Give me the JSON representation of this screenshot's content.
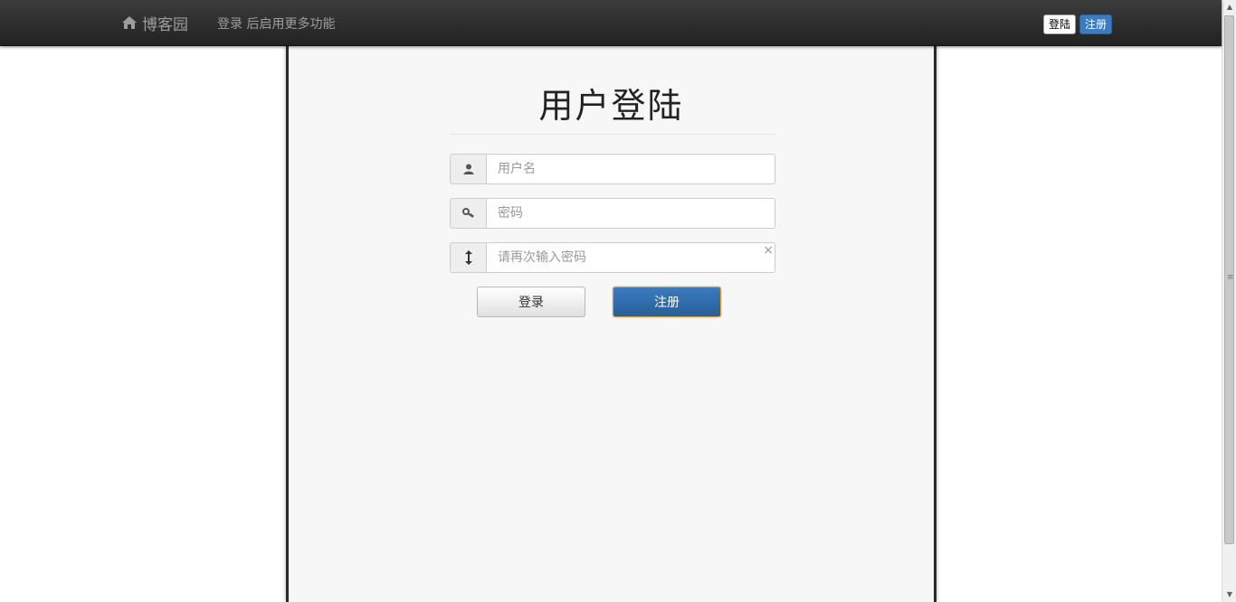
{
  "navbar": {
    "brand": "博客园",
    "brand_icon": "home-icon",
    "message": "登录 后启用更多功能",
    "login_label": "登陆",
    "register_label": "注册"
  },
  "form": {
    "title": "用户登陆",
    "username": {
      "placeholder": "用户名",
      "icon": "user-icon"
    },
    "password": {
      "placeholder": "密码",
      "icon": "key-icon"
    },
    "confirm": {
      "placeholder": "请再次输入密码",
      "icon": "vertical-arrows-icon",
      "clear": "×"
    },
    "login_button": "登录",
    "register_button": "注册"
  },
  "colors": {
    "navbar": "#2b2b2b",
    "primary": "#3a7cc4",
    "focus_border": "#e6a23c"
  }
}
